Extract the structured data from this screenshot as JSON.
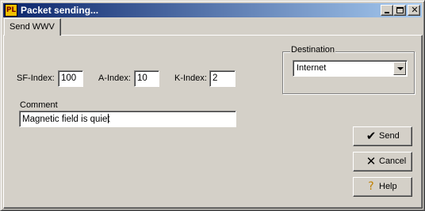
{
  "window": {
    "title": "Packet sending...",
    "app_icon": "PL",
    "controls": {
      "minimize": "minimize",
      "maximize": "maximize",
      "close": "close"
    }
  },
  "tabs": [
    {
      "label": "Send WWV",
      "active": true
    }
  ],
  "indices": {
    "sfi": {
      "label": "SF-Index:",
      "value": "100"
    },
    "a": {
      "label": "A-Index:",
      "value": "10"
    },
    "k": {
      "label": "K-Index:",
      "value": "2"
    }
  },
  "comment": {
    "label": "Comment",
    "value": "Magnetic field is quiet"
  },
  "destination": {
    "legend": "Destination",
    "selected": "Internet"
  },
  "buttons": {
    "send": {
      "label": "Send",
      "icon": "check-icon"
    },
    "cancel": {
      "label": "Cancel",
      "icon": "x-icon"
    },
    "help": {
      "label": "Help",
      "icon": "question-icon"
    }
  },
  "colors": {
    "titlebar_start": "#0a246a",
    "titlebar_end": "#a6caf0",
    "face": "#d4d0c8"
  }
}
